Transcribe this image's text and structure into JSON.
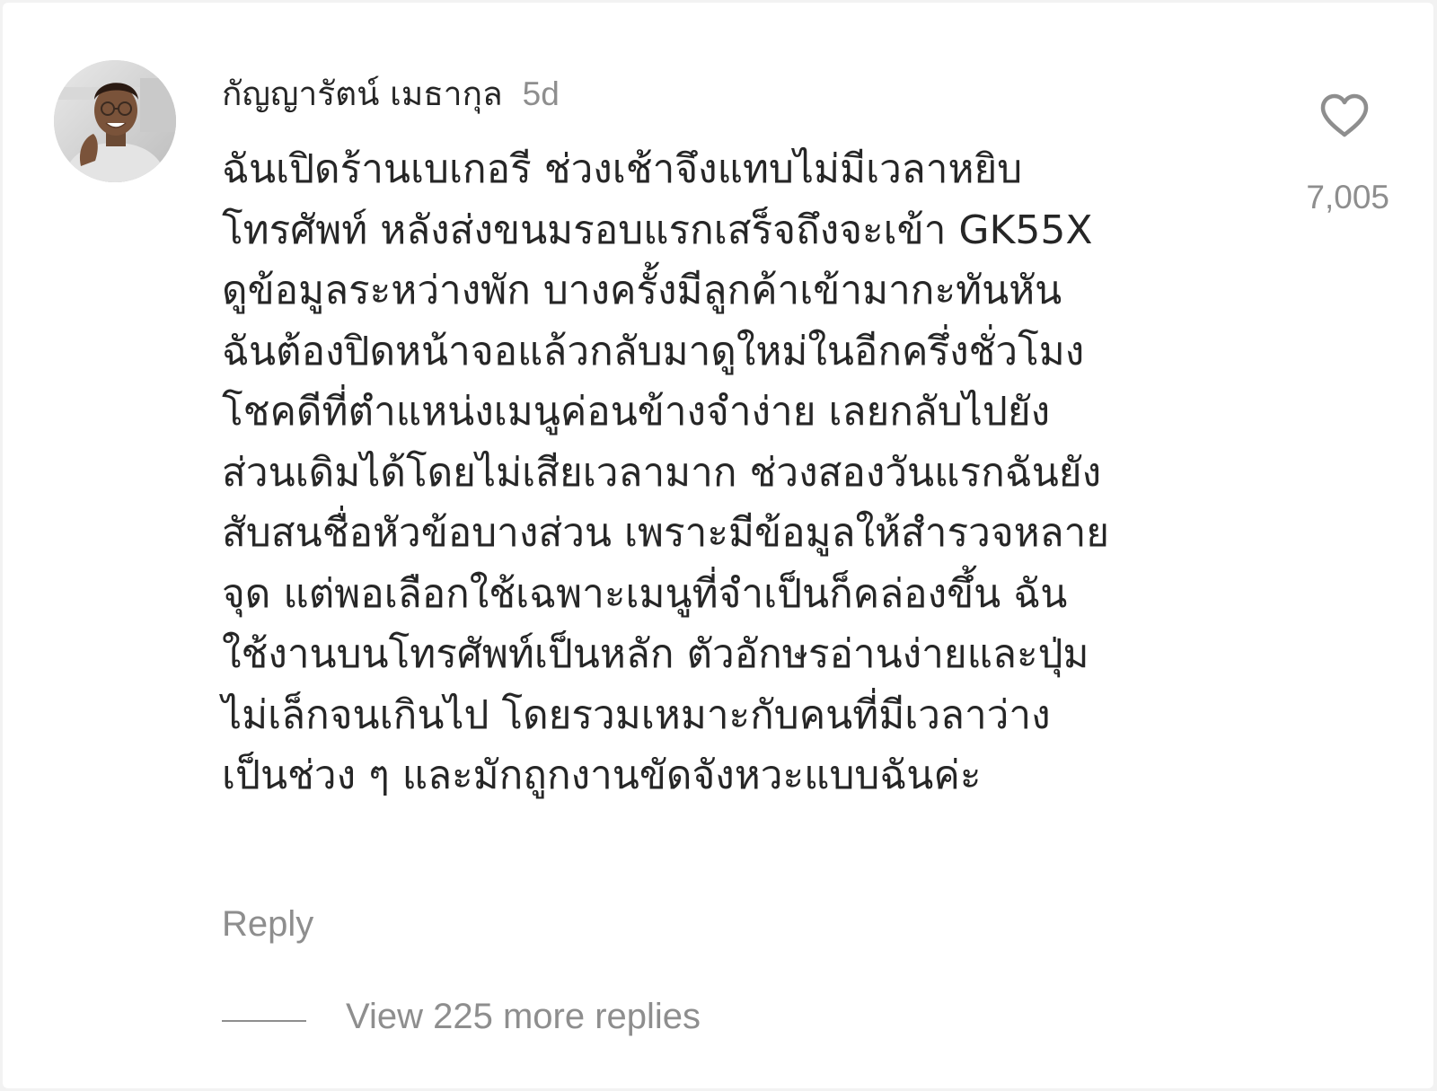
{
  "comment": {
    "username": "กัญญารัตน์ เมธากุล",
    "time_ago": "5d",
    "text": "ฉันเปิดร้านเบเกอรี ช่วงเช้าจึงแทบไม่มีเวลาหยิบ\nโทรศัพท์ หลังส่งขนมรอบแรกเสร็จถึงจะเข้า GK55X\nดูข้อมูลระหว่างพัก บางครั้งมีลูกค้าเข้ามากะทันหัน\nฉันต้องปิดหน้าจอแล้วกลับมาดูใหม่ในอีกครึ่งชั่วโมง\nโชคดีที่ตำแหน่งเมนูค่อนข้างจำง่าย เลยกลับไปยัง\nส่วนเดิมได้โดยไม่เสียเวลามาก ช่วงสองวันแรกฉันยัง\nสับสนชื่อหัวข้อบางส่วน เพราะมีข้อมูลให้สำรวจหลาย\nจุด แต่พอเลือกใช้เฉพาะเมนูที่จำเป็นก็คล่องขึ้น ฉัน\nใช้งานบนโทรศัพท์เป็นหลัก ตัวอักษรอ่านง่ายและปุ่ม\nไม่เล็กจนเกินไป โดยรวมเหมาะกับคนที่มีเวลาว่าง\nเป็นช่วง ๆ และมักถูกงานขัดจังหวะแบบฉันค่ะ",
    "like_count": "7,005",
    "like_icon": "heart-outline-icon",
    "reply_label": "Reply",
    "view_more_replies_label": "View 225 more replies"
  },
  "colors": {
    "text_primary": "#262626",
    "text_secondary": "#8e8e8e",
    "background": "#ffffff"
  }
}
